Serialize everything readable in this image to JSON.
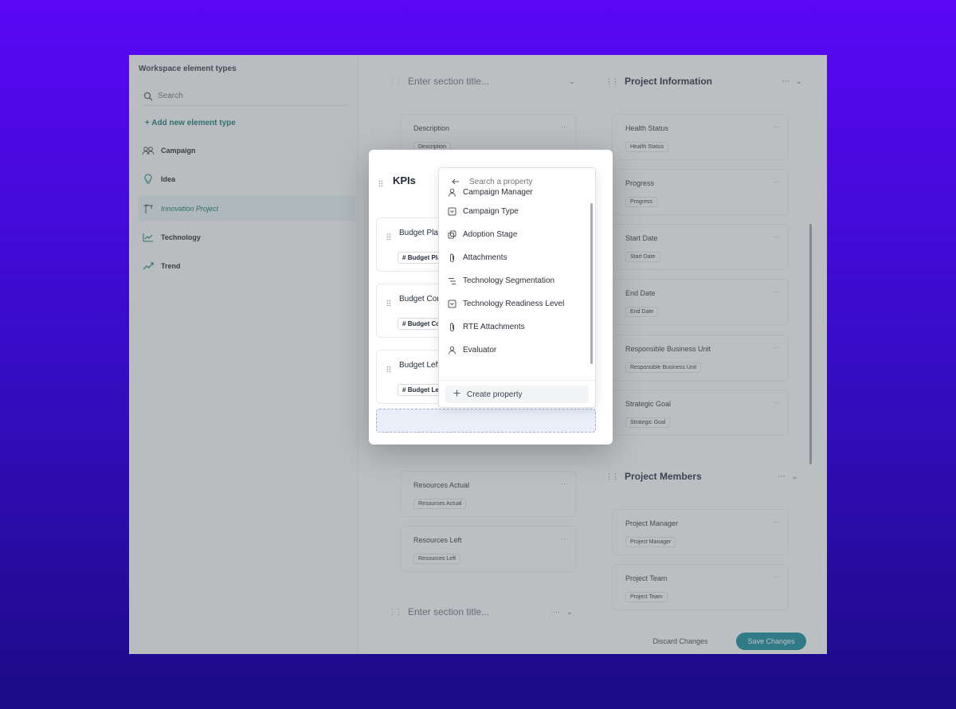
{
  "sidebar": {
    "title": "Workspace element types",
    "search_placeholder": "Search",
    "add_label": "+ Add new element type",
    "items": [
      {
        "label": "Campaign",
        "icon": "users-group-icon"
      },
      {
        "label": "Idea",
        "icon": "lightbulb-icon"
      },
      {
        "label": "Innovation Project",
        "icon": "crane-icon"
      },
      {
        "label": "Technology",
        "icon": "chart-line-icon"
      },
      {
        "label": "Trend",
        "icon": "trend-icon"
      }
    ]
  },
  "middle": {
    "section_placeholder_top": "Enter section title...",
    "section_placeholder_bottom": "Enter section title...",
    "cards": [
      {
        "label": "Description",
        "chip": "Description"
      },
      {
        "label": "Resources Actual",
        "chip": "Resources Actual"
      },
      {
        "label": "Resources Left",
        "chip": "Resources Left"
      }
    ]
  },
  "right": {
    "project_information_title": "Project Information",
    "project_members_title": "Project Members",
    "info_cards": [
      {
        "label": "Health Status",
        "chip": "Health Status"
      },
      {
        "label": "Progress",
        "chip": "Progress"
      },
      {
        "label": "Start Date",
        "chip": "Start Date"
      },
      {
        "label": "End Date",
        "chip": "End Date"
      },
      {
        "label": "Responsible Business Unit",
        "chip": "Responsible Business Unit"
      },
      {
        "label": "Strategic Goal",
        "chip": "Strategic Goal"
      }
    ],
    "member_cards": [
      {
        "label": "Project Manager",
        "chip": "Project Manager"
      },
      {
        "label": "Project Team",
        "chip": "Project Team"
      }
    ]
  },
  "footer": {
    "discard_label": "Discard Changes",
    "save_label": "Save Changes"
  },
  "modal": {
    "title": "KPIs",
    "cards": [
      {
        "label": "Budget Planned",
        "chip": "Budget Planned"
      },
      {
        "label": "Budget Consumed",
        "chip": "Budget Consumed"
      },
      {
        "label": "Budget Left",
        "chip": "Budget Left"
      }
    ]
  },
  "dropdown": {
    "search_placeholder": "Search a property",
    "items": [
      {
        "label": "Campaign Manager",
        "icon": "user-icon"
      },
      {
        "label": "Campaign Type",
        "icon": "select-box-icon"
      },
      {
        "label": "Adoption Stage",
        "icon": "copy-stack-icon"
      },
      {
        "label": "Attachments",
        "icon": "paperclip-icon"
      },
      {
        "label": "Technology Segmentation",
        "icon": "tree-list-icon"
      },
      {
        "label": "Technology Readiness Level",
        "icon": "select-box-icon"
      },
      {
        "label": "RTE Attachments",
        "icon": "paperclip-icon"
      },
      {
        "label": "Evaluator",
        "icon": "user-icon"
      }
    ],
    "create_label": "Create property"
  },
  "colors": {
    "accent": "#0f8a9a",
    "background_top": "#5a07f5",
    "background_bottom": "#1c0b86"
  }
}
